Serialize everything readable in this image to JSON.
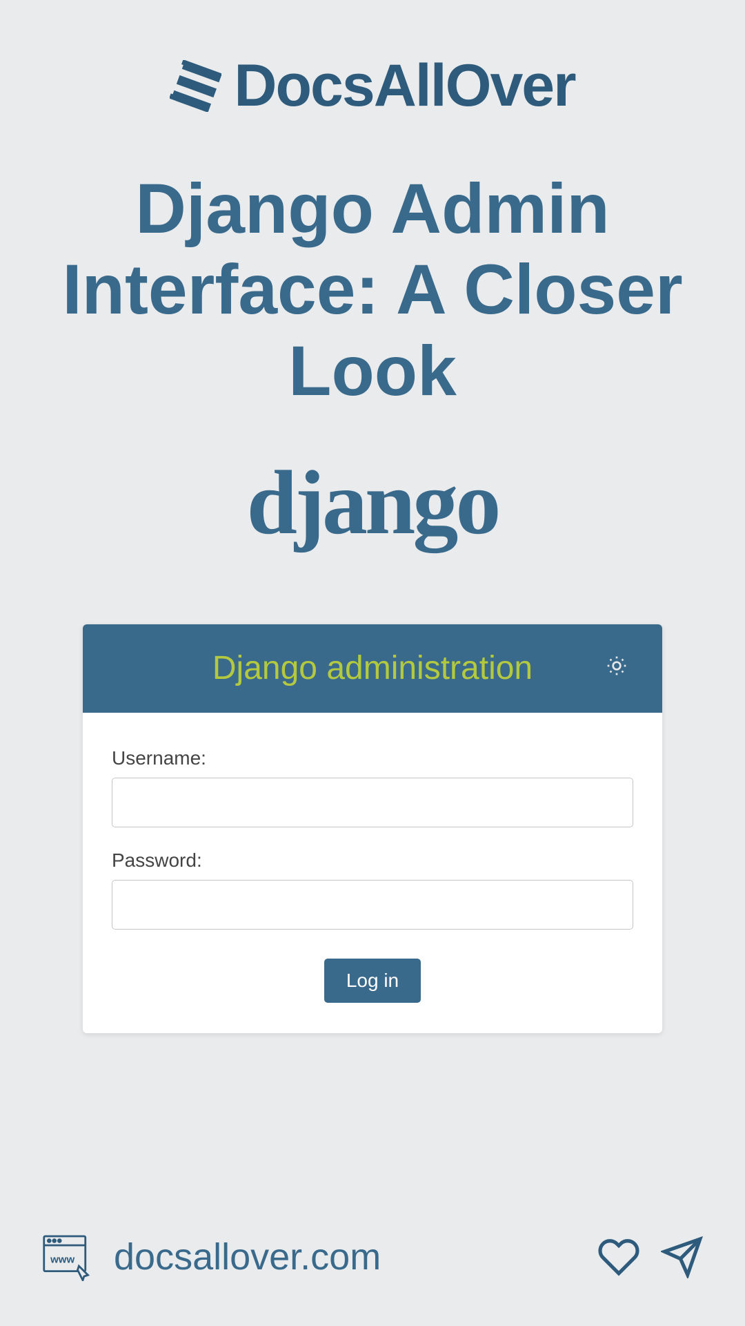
{
  "header": {
    "brand": "DocsAllOver"
  },
  "title": "Django Admin Interface: A Closer Look",
  "django_logo_text": "django",
  "admin": {
    "header_title": "Django administration",
    "username_label": "Username:",
    "password_label": "Password:",
    "login_button": "Log in"
  },
  "footer": {
    "url": "docsallover.com"
  }
}
